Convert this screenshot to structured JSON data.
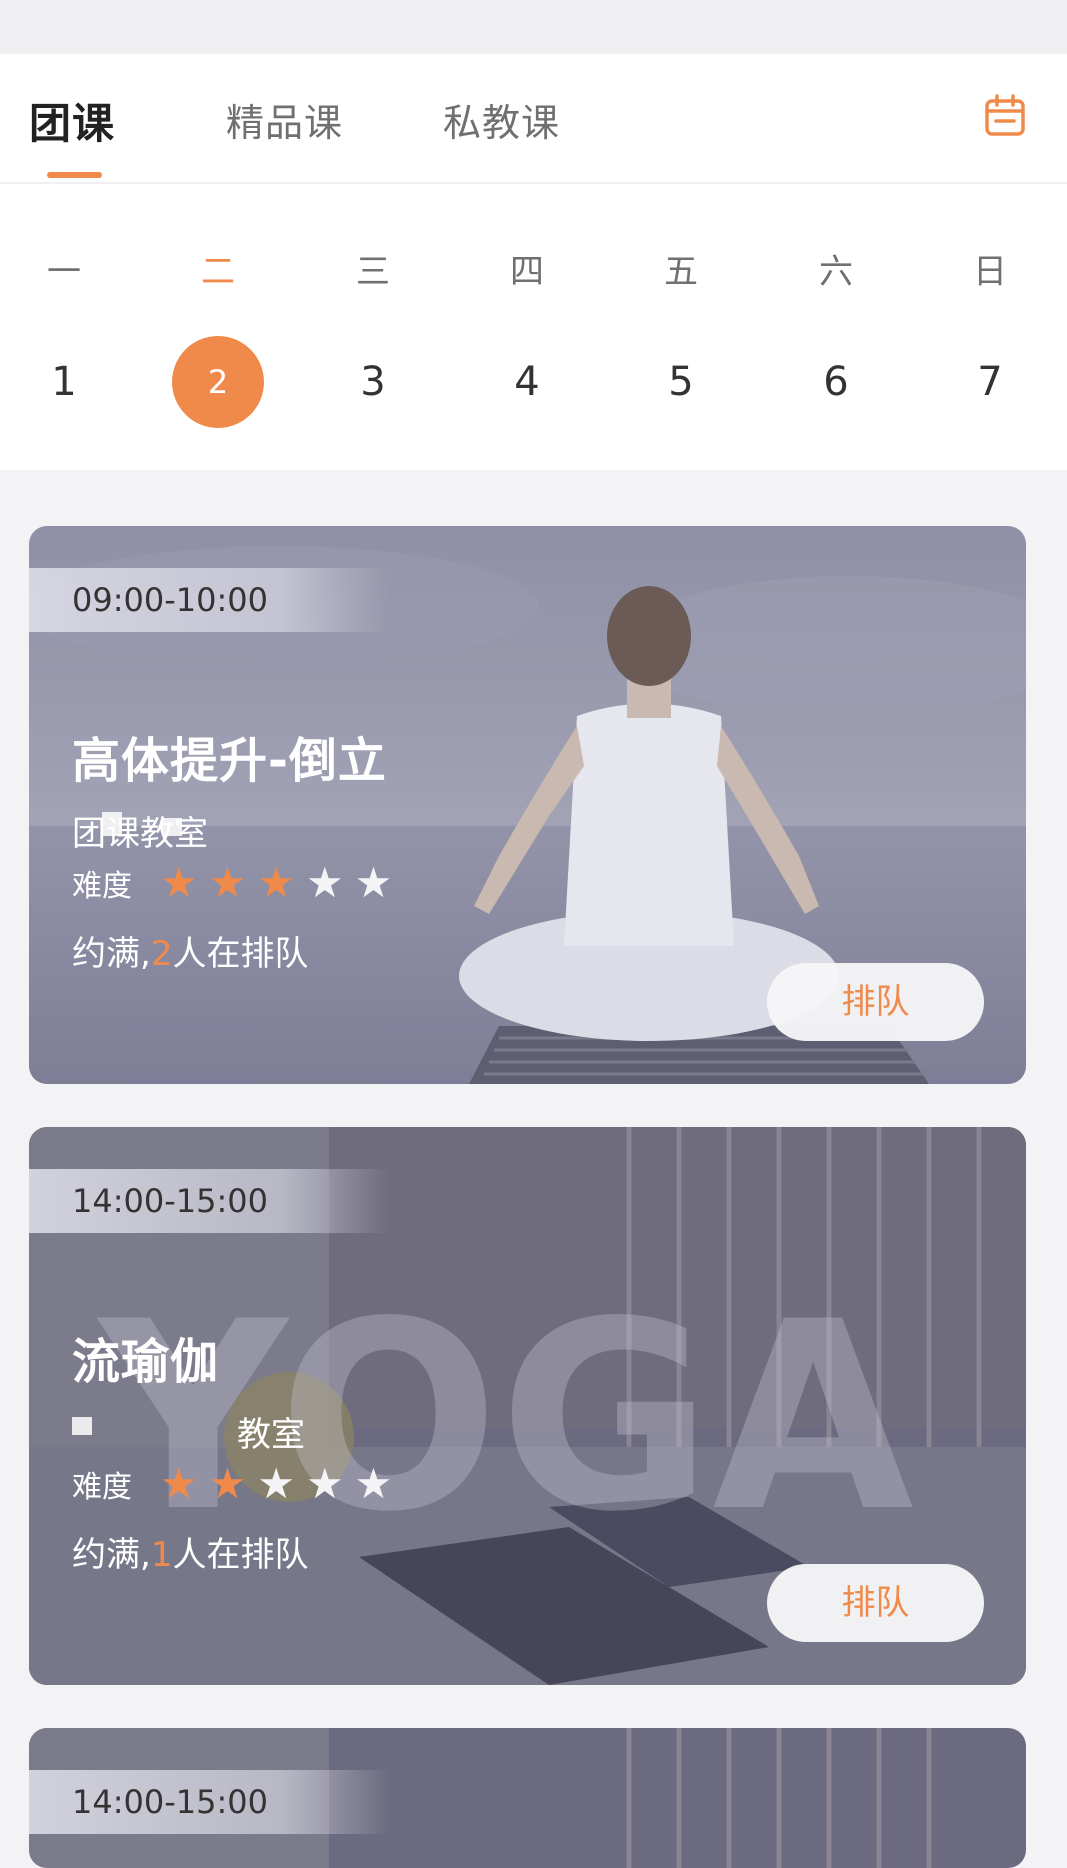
{
  "tabs": [
    {
      "label": "团课",
      "active": true
    },
    {
      "label": "精品课",
      "active": false
    },
    {
      "label": "私教课",
      "active": false
    }
  ],
  "calendar_icon": "calendar-icon",
  "accent_color": "#f08a4b",
  "weekdays": [
    "一",
    "二",
    "三",
    "四",
    "五",
    "六",
    "日"
  ],
  "dates": [
    "1",
    "2",
    "3",
    "4",
    "5",
    "6",
    "7"
  ],
  "selected_index": 1,
  "courses": [
    {
      "time": "09:00-10:00",
      "title": "高体提升-倒立",
      "room": "团课教室",
      "difficulty_label": "难度",
      "difficulty": 3,
      "max_difficulty": 5,
      "queue_prefix": "约满,",
      "queue_count": "2",
      "queue_suffix": "人在排队",
      "button": "排队",
      "image": "yoga-meditation-sea"
    },
    {
      "time": "14:00-15:00",
      "title": "流瑜伽",
      "room": "教室",
      "difficulty_label": "难度",
      "difficulty": 2,
      "max_difficulty": 5,
      "queue_prefix": "约满,",
      "queue_count": "1",
      "queue_suffix": "人在排队",
      "button": "排队",
      "image": "yoga-studio"
    },
    {
      "time": "14:00-15:00",
      "image": "yoga-studio"
    }
  ]
}
